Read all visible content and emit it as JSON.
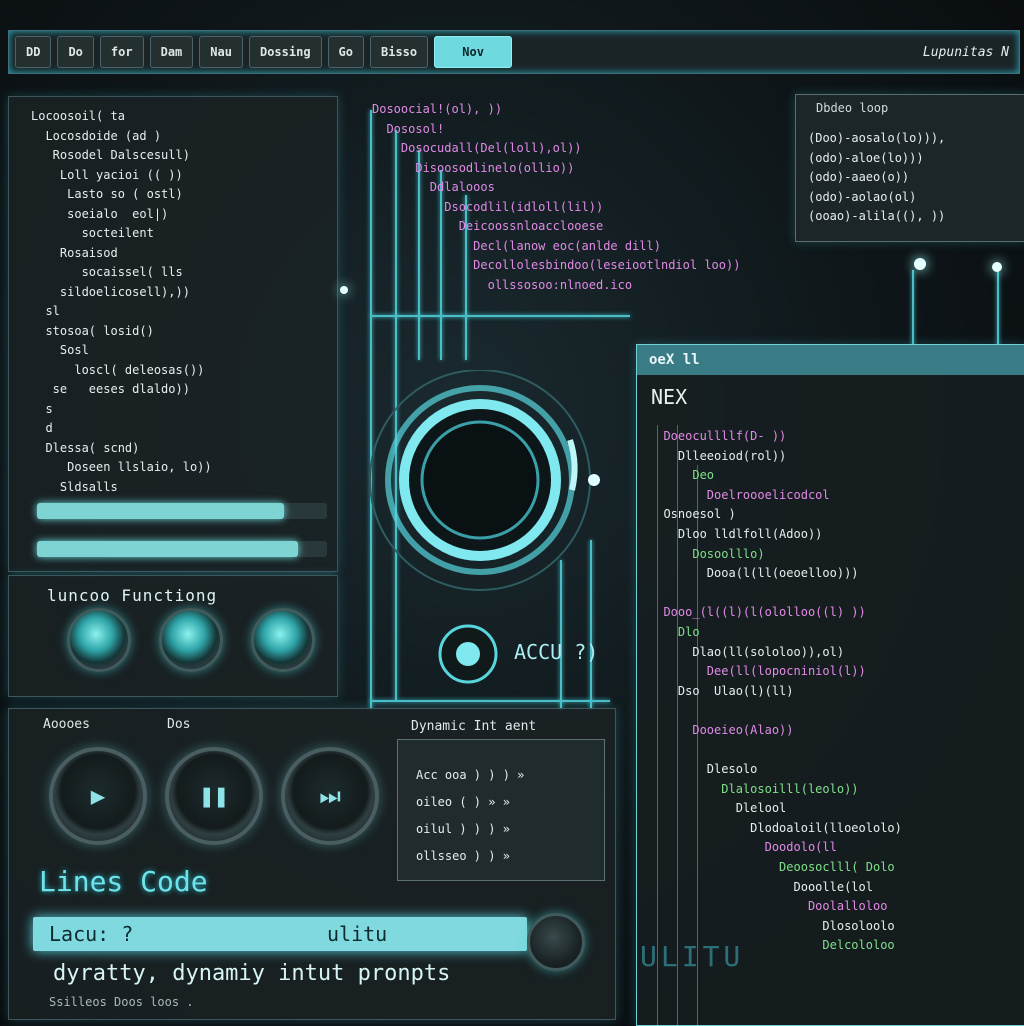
{
  "menubar": {
    "items": [
      "DD",
      "Do",
      "for",
      "Dam",
      "Nau",
      "Dossing",
      "Go",
      "Bisso",
      "Nov"
    ],
    "active_index": 8,
    "right_label": "Lupunitas N"
  },
  "left_code": {
    "lines": [
      "Locoosoil( ta",
      "  Locosdoide (ad )",
      "   Rosodel Dalscesull)",
      "    Loll yacioi (( ))",
      "     Lasto so ( ostl)",
      "     soeialo  eol|)",
      "       socteilent",
      "    Rosaisod",
      "       socaissel( lls",
      "    sildoelicosell),))",
      "  sl",
      "  stosoa( losid()",
      "    Sosl",
      "      loscl( deleosas())",
      "   se   eeses dlaldo))",
      "  s",
      "  d",
      "  Dlessa( scnd)",
      "     Doseen llslaio, lo))",
      "    Sldsalls"
    ],
    "progress": [
      0.85,
      0.9
    ]
  },
  "functions": {
    "label": "luncoo Functiong"
  },
  "bottom_left": {
    "left_label": "Aoooes",
    "mid_label": "Dos",
    "dynamic_title": "Dynamic Int aent",
    "dynamic_lines": [
      "Acc ooa ) ) ) »",
      "oileo ( ) » »",
      "oilul ) ) ) »",
      "ollsseo ) ) »"
    ],
    "lines_code": "Lines Code",
    "input_left": "Lacu: ?",
    "input_right": "ulitu",
    "prompt": "dyratty, dynamiy intut pronpts",
    "footer": "Ssilleos    Doos loos ."
  },
  "center_code": {
    "lines": [
      "Dosoocial!(ol), ))",
      "  Dososol!",
      "    Dosocudall(Del(loll),ol))",
      "      Disoosodlinelo(ollio))",
      "        Ddlalooos",
      "          Dsocodlil(idloll(lil))",
      "            Deicoossnloacclooese",
      "              Decl(lanow eoc(anlde dill)",
      "              Decollolesbindoo(leseiootlndiol loo))",
      "                ollssosoo:nlnoed.ico"
    ]
  },
  "accu_label": "ACCU ?)",
  "top_right": {
    "header": "Dbdeo  loop",
    "lines": [
      "(Doo)-aosalo(lo))),",
      "(odo)-aloe(lo)))",
      "(odo)-aaeo(o))",
      "(odo)-aolao(ol)",
      "(ooao)-alila((), ))"
    ]
  },
  "nex": {
    "title": "oeX ll",
    "big_label": "NEX",
    "lines": [
      "  Doeocullllf(D- ))",
      "    Dlleeoiod(rol))",
      "      Deo",
      "        Doelroooelicodcol",
      "  Osnoesol )",
      "    Dloo lldlfoll(Adoo))",
      "      Dosoolllo)",
      "        Dooa(l(ll(oeoelloo)))",
      "",
      "  Dooo_(l((l)(l(ololloo((l) ))",
      "    Dlo",
      "      Dlao(ll(sololoo)),ol)",
      "        Dee(ll(lopocniniol(l))",
      "    Dso  Ulao(l)(ll)",
      "",
      "      Dooeieo(Alao))",
      "",
      "        Dlesolo",
      "          Dlalosoilll(leolo))",
      "            Dlelool",
      "              Dlodoaloil(lloeololo)",
      "                Doodolo(ll",
      "                  Deoosoclll( Dolo",
      "                    Dooolle(lol",
      "                      Doolalloloo",
      "                        Dlosoloolo",
      "                        Delcololoo"
    ]
  },
  "watermark": "ULITU",
  "colors": {
    "accent": "#6fd9e0",
    "panel": "#1a2326",
    "magenta": "#e18ae6"
  }
}
